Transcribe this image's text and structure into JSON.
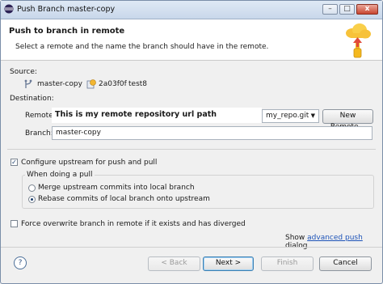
{
  "window": {
    "title": "Push Branch master-copy",
    "controls": {
      "minimize": "–",
      "maximize": "□",
      "close": "x"
    }
  },
  "header": {
    "title": "Push to branch in remote",
    "description": "Select a remote and the name the branch should have in the remote."
  },
  "source": {
    "label": "Source:",
    "branch": "master-copy",
    "commit_id": "2a03f0f",
    "commit_message": "test8"
  },
  "destination": {
    "label": "Destination:",
    "remote_label": "Remote:",
    "remote_url_overlay": "This is my remote repository url path",
    "remote_selected": "my_repo.git",
    "new_remote_button": "New Remote...",
    "branch_label": "Branch:",
    "branch_value": "master-copy"
  },
  "upstream": {
    "checkbox_label": "Configure upstream for push and pull",
    "checked": true,
    "group_label": "When doing a pull",
    "options": [
      {
        "label": "Merge upstream commits into local branch",
        "selected": false
      },
      {
        "label": "Rebase commits of local branch onto upstream",
        "selected": true
      }
    ]
  },
  "force": {
    "checkbox_label": "Force overwrite branch in remote if it exists and has diverged",
    "checked": false
  },
  "show_advanced": {
    "prefix": "Show ",
    "link": "advanced push",
    "suffix": " dialog"
  },
  "footer": {
    "help_icon": "?",
    "back": "< Back",
    "next": "Next >",
    "finish": "Finish",
    "cancel": "Cancel"
  },
  "icons": {
    "app": "eclipse-icon",
    "wizard": "cloud-upload-icon",
    "branch": "branch-icon",
    "commit": "commit-icon"
  }
}
